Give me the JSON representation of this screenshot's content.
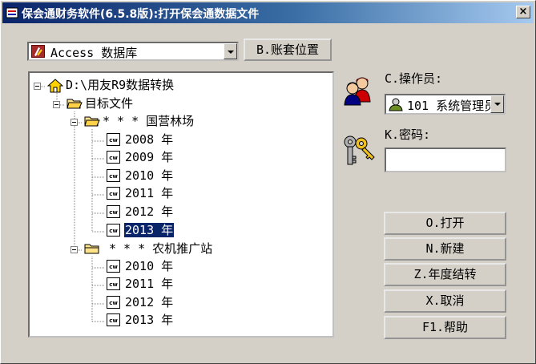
{
  "window": {
    "title": "保会通财务软件(6.5.8版):打开保会通数据文件",
    "close_label": "×"
  },
  "db_selector": {
    "value": "Access 数据库",
    "icon": "access-icon"
  },
  "account_location_button": "B.账套位置",
  "tree": {
    "root": "D:\\用友R9数据转换",
    "folder": "目标文件",
    "companies": [
      {
        "name": "* * *  国营林场",
        "years": [
          "2008 年",
          "2009 年",
          "2010 年",
          "2011 年",
          "2012 年",
          "2013 年"
        ]
      },
      {
        "name": "* * * 农机推广站",
        "years": [
          "2010 年",
          "2011 年",
          "2012 年",
          "2013 年"
        ]
      }
    ],
    "selected": "2013 年"
  },
  "operator": {
    "label": "C.操作员:",
    "value": "101 系统管理员",
    "icon": "user-icon"
  },
  "password": {
    "label": "K.密码:",
    "value": ""
  },
  "buttons": {
    "open": "O.打开",
    "new": "N.新建",
    "year_end": "Z.年度结转",
    "cancel": "X.取消",
    "help": "F1.帮助"
  },
  "colors": {
    "title_start": "#0a246a",
    "title_end": "#a6caf0",
    "selection": "#0a246a",
    "face": "#d4d0c8"
  }
}
